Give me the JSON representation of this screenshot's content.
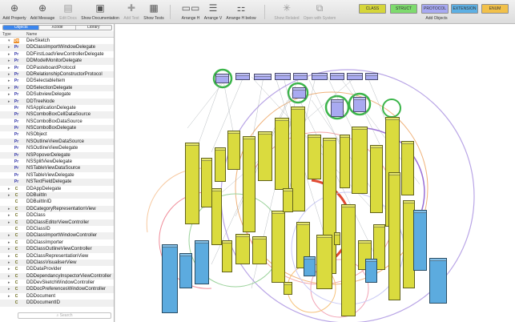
{
  "toolbar": {
    "buttons": [
      {
        "name": "add-property-button",
        "label": "Add Property",
        "icon": "plus-circle-icon",
        "dim": false
      },
      {
        "name": "add-message-button",
        "label": "Add Message",
        "icon": "plus-circle-icon",
        "dim": false
      },
      {
        "name": "edit-docs-button",
        "label": "Edit Docs",
        "icon": "document-icon",
        "dim": true
      },
      {
        "name": "show-documentation-button",
        "label": "Show Documentation",
        "icon": "documentation-icon",
        "dim": false
      },
      {
        "name": "add-test-button",
        "label": "Add Test",
        "icon": "test-add-icon",
        "dim": true
      },
      {
        "name": "show-tests-button",
        "label": "Show Tests",
        "icon": "test-icon",
        "dim": false
      },
      {
        "name": "arrange-h-button",
        "label": "Arrange H",
        "icon": "arrange-horizontal-icon",
        "dim": false
      },
      {
        "name": "arrange-v-button",
        "label": "Arrange V",
        "icon": "arrange-vertical-icon",
        "dim": false
      },
      {
        "name": "arrange-h-below-button",
        "label": "Arrange H below",
        "icon": "arrange-below-icon",
        "dim": false
      },
      {
        "name": "show-related-button",
        "label": "Show Related",
        "icon": "related-icon",
        "dim": true
      },
      {
        "name": "open-with-system-button",
        "label": "Open with System",
        "icon": "open-external-icon",
        "dim": true
      }
    ],
    "add_objects": {
      "label": "Add Objects",
      "types": [
        {
          "label": "CLASS",
          "color": "#d6d63a"
        },
        {
          "label": "STRUCT",
          "color": "#7edb6e"
        },
        {
          "label": "PROTOCOL",
          "color": "#a7a9f2"
        },
        {
          "label": "EXTENSION",
          "color": "#5db0e4"
        },
        {
          "label": "ENUM",
          "color": "#f2c14a"
        }
      ]
    }
  },
  "sidebar": {
    "tabs": [
      "Objects",
      "Xcode",
      "Library"
    ],
    "active_tab": "Objects",
    "columns": {
      "type": "Type",
      "name": "Name"
    },
    "search_placeholder": "Search",
    "rows": [
      {
        "type": "Do",
        "name": "DevSketch",
        "disclosure": "▾"
      },
      {
        "type": "Pr",
        "name": "DDClassImportWindowDelegate",
        "disclosure": "▸"
      },
      {
        "type": "Pr",
        "name": "DDFirstLoadViewControllerDelegate",
        "disclosure": "▸"
      },
      {
        "type": "Pr",
        "name": "DDModelMonitorDelegate",
        "disclosure": "▸"
      },
      {
        "type": "Pr",
        "name": "DDPasteboardProtocol",
        "disclosure": "▸"
      },
      {
        "type": "Pr",
        "name": "DDRelationshipConstructorProtocol",
        "disclosure": "▸"
      },
      {
        "type": "Pr",
        "name": "DDSelectableItem",
        "disclosure": "▸"
      },
      {
        "type": "Pr",
        "name": "DDSelectionDelegate",
        "disclosure": "▸"
      },
      {
        "type": "Pr",
        "name": "DDSubviewDelegate",
        "disclosure": "▸"
      },
      {
        "type": "Pr",
        "name": "DDTreeNode",
        "disclosure": "▸"
      },
      {
        "type": "Pr",
        "name": "NSApplicationDelegate",
        "disclosure": ""
      },
      {
        "type": "Pr",
        "name": "NSComboBoxCellDataSource",
        "disclosure": ""
      },
      {
        "type": "Pr",
        "name": "NSComboBoxDataSource",
        "disclosure": ""
      },
      {
        "type": "Pr",
        "name": "NSComboBoxDelegate",
        "disclosure": ""
      },
      {
        "type": "Pr",
        "name": "NSObject",
        "disclosure": ""
      },
      {
        "type": "Pr",
        "name": "NSOutlineViewDataSource",
        "disclosure": ""
      },
      {
        "type": "Pr",
        "name": "NSOutlineViewDelegate",
        "disclosure": ""
      },
      {
        "type": "Pr",
        "name": "NSPopoverDelegate",
        "disclosure": ""
      },
      {
        "type": "Pr",
        "name": "NSSplitViewDelegate",
        "disclosure": ""
      },
      {
        "type": "Pr",
        "name": "NSTableViewDataSource",
        "disclosure": ""
      },
      {
        "type": "Pr",
        "name": "NSTableViewDelegate",
        "disclosure": ""
      },
      {
        "type": "Pr",
        "name": "NSTextFieldDelegate",
        "disclosure": ""
      },
      {
        "type": "C",
        "name": "DDAppDelegate",
        "disclosure": "▸"
      },
      {
        "type": "C",
        "name": "DDBuiltIn",
        "disclosure": "▸"
      },
      {
        "type": "C",
        "name": "DDBuiltInID",
        "disclosure": ""
      },
      {
        "type": "C",
        "name": "DDCategoryRepresentationView",
        "disclosure": "▸"
      },
      {
        "type": "C",
        "name": "DDClass",
        "disclosure": "▸"
      },
      {
        "type": "C",
        "name": "DDClassEditorViewController",
        "disclosure": "▸"
      },
      {
        "type": "C",
        "name": "DDClassID",
        "disclosure": ""
      },
      {
        "type": "C",
        "name": "DDClassImportWindowController",
        "disclosure": "▸"
      },
      {
        "type": "C",
        "name": "DDClassImporter",
        "disclosure": "▸"
      },
      {
        "type": "C",
        "name": "DDClassOutlineViewController",
        "disclosure": "▸"
      },
      {
        "type": "C",
        "name": "DDClassRepresentationView",
        "disclosure": "▸"
      },
      {
        "type": "C",
        "name": "DDClassVisualiserView",
        "disclosure": "▸"
      },
      {
        "type": "C",
        "name": "DDDataProvider",
        "disclosure": "▸"
      },
      {
        "type": "C",
        "name": "DDDependancyInspectorViewController",
        "disclosure": "▸"
      },
      {
        "type": "C",
        "name": "DDDevSketchWindowController",
        "disclosure": "▸"
      },
      {
        "type": "C",
        "name": "DDDocPreferencesWindowController",
        "disclosure": "▸"
      },
      {
        "type": "C",
        "name": "DDDocument",
        "disclosure": "▸"
      },
      {
        "type": "C",
        "name": "DDDocumentID",
        "disclosure": ""
      }
    ]
  },
  "colors": {
    "class_fill": "#dadb3e",
    "protocol_fill": "#a9aaf1",
    "extension_fill": "#5cabdf",
    "selection_accent": "#3b86ee",
    "circle_green": "#3bb54a",
    "circle_red": "#e04a32",
    "circle_purple": "#9a6fd6",
    "circle_orange": "#f0a050"
  }
}
